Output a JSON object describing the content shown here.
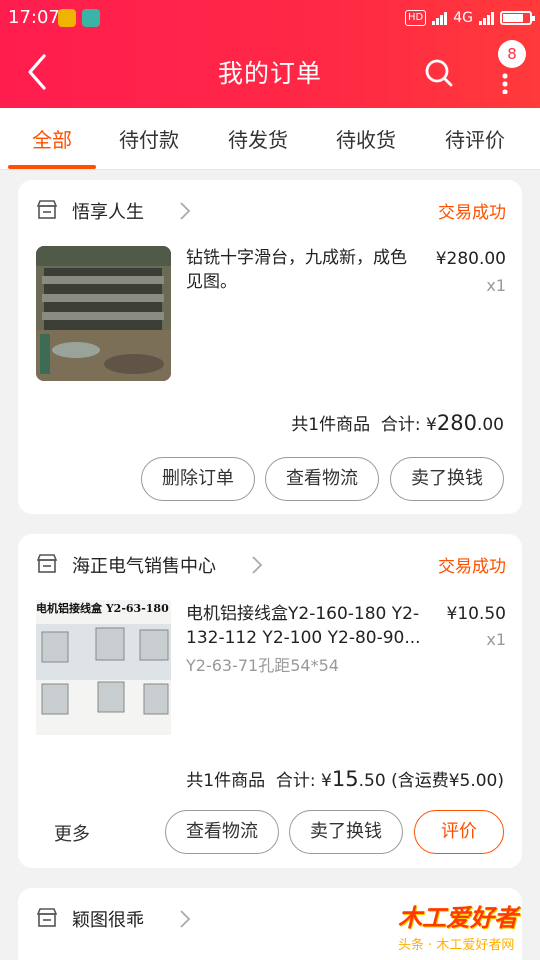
{
  "status_bar": {
    "time": "17:07",
    "network": "4G",
    "hd": "HD",
    "signal1": "4G"
  },
  "header": {
    "title": "我的订单",
    "badge": "8"
  },
  "tabs": [
    {
      "label": "全部",
      "active": true
    },
    {
      "label": "待付款"
    },
    {
      "label": "待发货"
    },
    {
      "label": "待收货"
    },
    {
      "label": "待评价"
    }
  ],
  "orders": [
    {
      "shop": "悟享人生",
      "status": "交易成功",
      "title": "钻铣十字滑台，九成新，成色见图。",
      "price": "¥280.00",
      "qty": "x1",
      "summary": {
        "count": "共1件商品",
        "total_label": "合计:",
        "currency": "¥",
        "total_int": "280",
        "total_dec": ".00"
      },
      "buttons": [
        "删除订单",
        "查看物流",
        "卖了换钱"
      ]
    },
    {
      "shop": "海正电气销售中心",
      "status": "交易成功",
      "title": "电机铝接线盒Y2-160-180 Y2-132-112 Y2-100 Y2-80-90...",
      "spec": "Y2-63-71孔距54*54",
      "image_text": "电机铝接线盒 Y2-63-180",
      "price": "¥10.50",
      "qty": "x1",
      "summary": {
        "count": "共1件商品",
        "total_label": "合计:",
        "currency": "¥",
        "total_int": "15",
        "total_dec": ".50",
        "shipping": "(含运费¥5.00)"
      },
      "more": "更多",
      "buttons": [
        "查看物流",
        "卖了换钱",
        "评价"
      ]
    },
    {
      "shop": "颖图很乖"
    }
  ],
  "watermark": {
    "logo": "木工爱好者",
    "sub": "头条 · 木工爱好者网"
  },
  "colors": {
    "accent": "#ff5000",
    "header": "#ff2845"
  }
}
